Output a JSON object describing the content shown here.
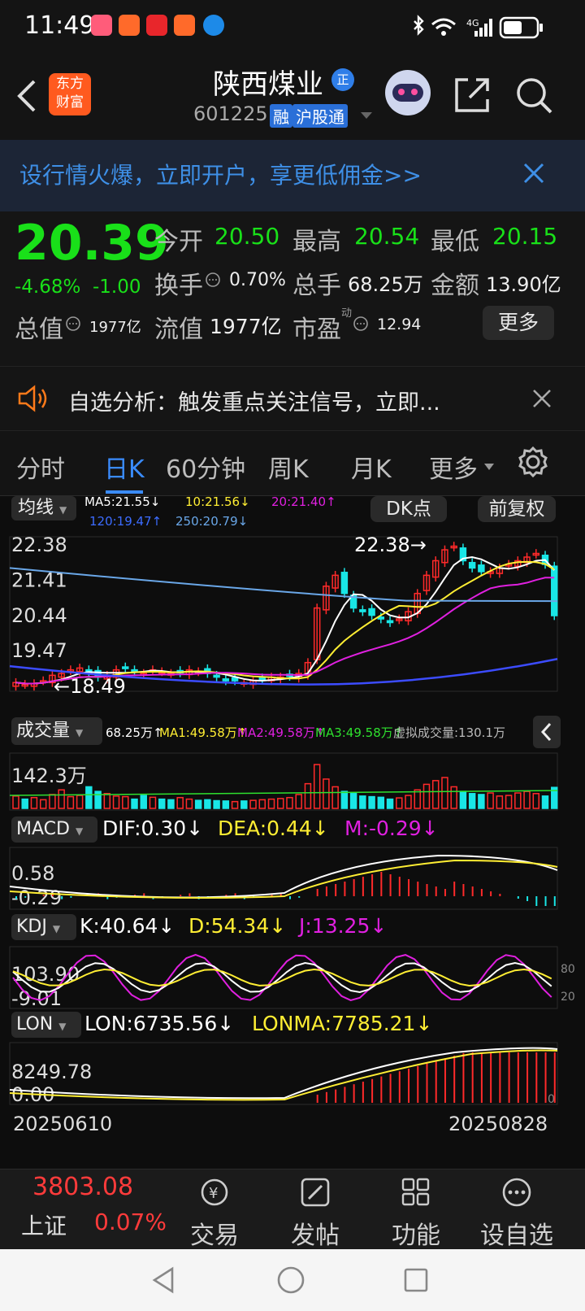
{
  "status_bar": {
    "time": "11:49",
    "battery_icon": "battery-icon",
    "signal_label": "4G"
  },
  "header": {
    "logo_text_line1": "东方",
    "logo_text_line2": "财富",
    "stock_name": "陕西煤业",
    "stock_badge": "正",
    "stock_code": "601225",
    "tag_margin": "融",
    "tag_connect": "沪股通"
  },
  "banner": {
    "text": "设行情火爆，立即开户，享更低佣金>>"
  },
  "quote": {
    "price": "20.39",
    "change_pct": "-4.68%",
    "change": "-1.00",
    "open_label": "今开",
    "open": "20.50",
    "high_label": "最高",
    "high": "20.54",
    "low_label": "最低",
    "low": "20.15",
    "turnover_label": "换手",
    "turnover": "0.70%",
    "volume_label": "总手",
    "volume": "68.25万",
    "amount_label": "金额",
    "amount": "13.90亿",
    "mktcap_label": "总值",
    "mktcap": "1977亿",
    "float_label": "流值",
    "float": "1977亿",
    "pe_label": "市盈",
    "pe_sup": "动",
    "pe": "12.94",
    "more_label": "更多"
  },
  "notice": {
    "text": "自选分析：触发重点关注信号，立即..."
  },
  "tabs": [
    {
      "label": "分时"
    },
    {
      "label": "日K"
    },
    {
      "label": "60分钟"
    },
    {
      "label": "周K"
    },
    {
      "label": "月K"
    },
    {
      "label": "更多"
    }
  ],
  "chart_controls": {
    "ma_selector": "均线",
    "ma5": "MA5:21.55↓",
    "ma10": "10:21.56↓",
    "ma20": "20:21.40↑",
    "ma120": "120:19.47↑",
    "ma250": "250:20.79↓",
    "dk_button": "DK点",
    "adjust_button": "前复权"
  },
  "kline": {
    "y_top": "22.38",
    "y_2": "21.41",
    "y_3": "20.44",
    "y_4": "19.47",
    "y_5": "18.5",
    "high_marker": "22.38",
    "low_marker": "18.49"
  },
  "volume": {
    "selector": "成交量",
    "vol": "68.25万↑",
    "ma1": "MA1:49.58万↑",
    "ma2": "MA2:49.58万↑",
    "ma3": "MA3:49.58万↑",
    "virtual": "虚拟成交量:130.1万",
    "y_top": "142.3万"
  },
  "macd": {
    "selector": "MACD",
    "dif": "DIF:0.30↓",
    "dea": "DEA:0.44↓",
    "m": "M:-0.29↓",
    "y_top": "0.58",
    "y_bottom": "-0.29"
  },
  "kdj": {
    "selector": "KDJ",
    "k": "K:40.64↓",
    "d": "D:54.34↓",
    "j": "J:13.25↓",
    "y_top": "103.90",
    "y_bottom": "-9.01",
    "r_top": "80",
    "r_bottom": "20"
  },
  "lon": {
    "selector": "LON",
    "lon": "LON:6735.56↓",
    "lonma": "LONMA:7785.21↓",
    "y_top": "8249.78",
    "y_bottom": "0.00",
    "r_bottom": "0"
  },
  "dates": {
    "start": "20250610",
    "end": "20250828"
  },
  "bottom_nav": {
    "index_value": "3803.08",
    "index_name": "上证",
    "index_change": "0.07%",
    "trade": "交易",
    "post": "发帖",
    "functions": "功能",
    "watchlist": "设自选"
  },
  "colors": {
    "up": "#ff2a2a",
    "down": "#19e6e6",
    "ma5": "#ffffff",
    "ma10": "#ffee33",
    "ma20": "#e020e0",
    "ma120": "#3c4cff",
    "ma250": "#6aa7e8",
    "accent": "#3a8cff"
  }
}
